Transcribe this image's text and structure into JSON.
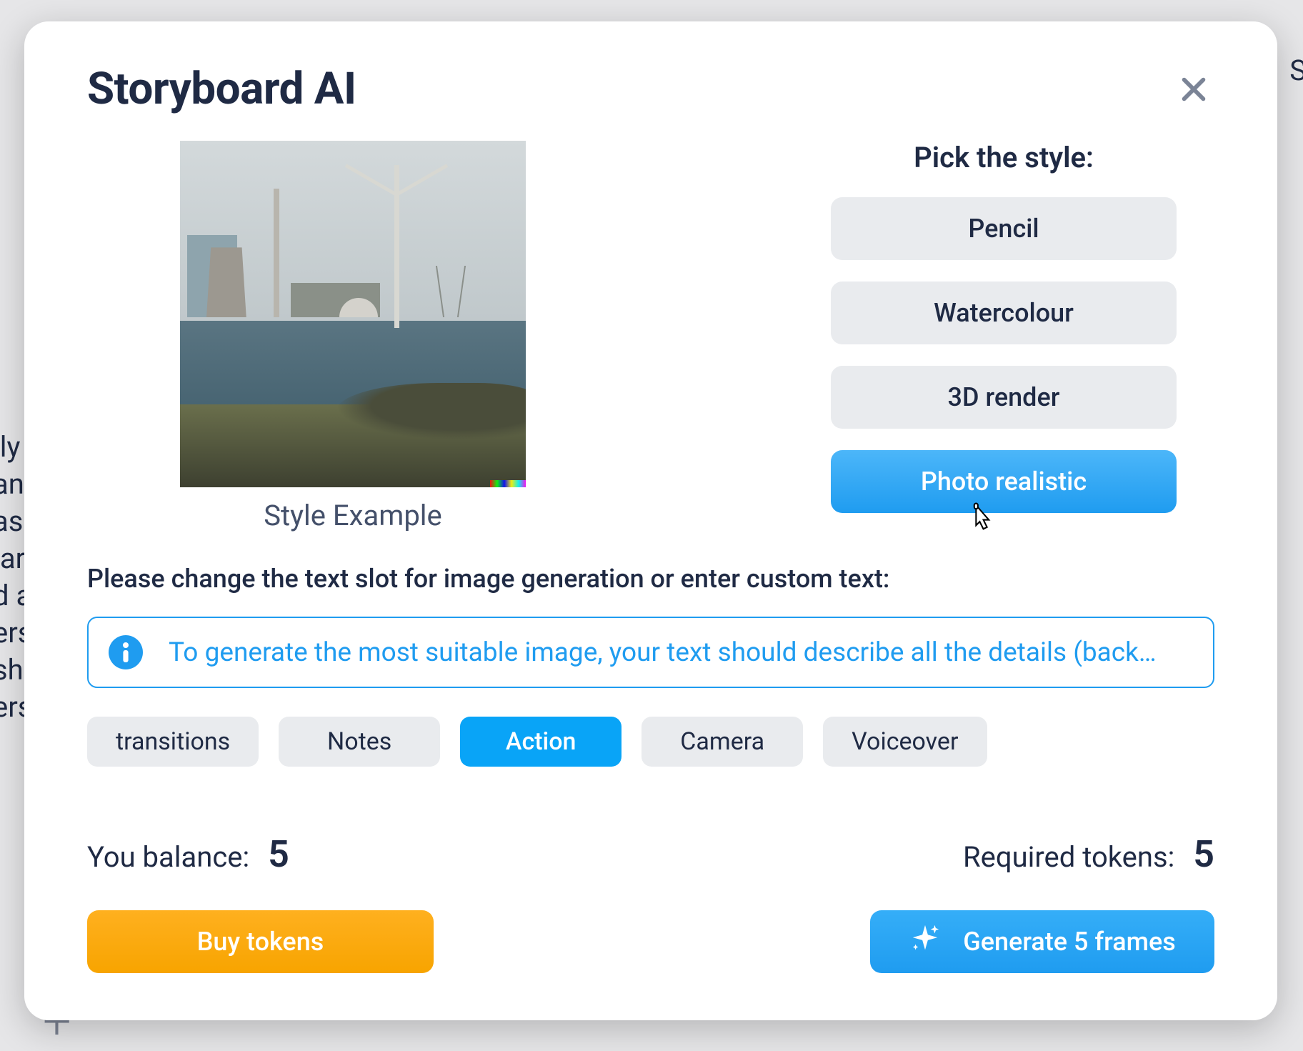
{
  "modal": {
    "title": "Storyboard AI",
    "styleExampleCaption": "Style Example",
    "pickStyleLabel": "Pick the style:",
    "styles": [
      {
        "label": "Pencil",
        "active": false
      },
      {
        "label": "Watercolour",
        "active": false
      },
      {
        "label": "3D render",
        "active": false
      },
      {
        "label": "Photo realistic",
        "active": true
      }
    ],
    "instruction": "Please change the text slot for image generation or enter custom text:",
    "infoText": "To generate the most suitable image, your text should describe all the details (back…",
    "slots": [
      {
        "label": "transitions",
        "active": false
      },
      {
        "label": "Notes",
        "active": false
      },
      {
        "label": "Action",
        "active": true
      },
      {
        "label": "Camera",
        "active": false
      },
      {
        "label": "Voiceover",
        "active": false
      }
    ],
    "balance": {
      "label": "You balance:",
      "value": "5"
    },
    "required": {
      "label": "Required tokens:",
      "value": "5"
    },
    "buyTokensLabel": "Buy tokens",
    "generateLabel": "Generate 5 frames"
  },
  "background": {
    "leftText": "ily\nan\nas\n ar\nd a\ners\nsh\ners",
    "rightPartial": "S"
  },
  "colors": {
    "accent": "#1f9cf0",
    "warning": "#f7a400",
    "text": "#1f2a44"
  }
}
